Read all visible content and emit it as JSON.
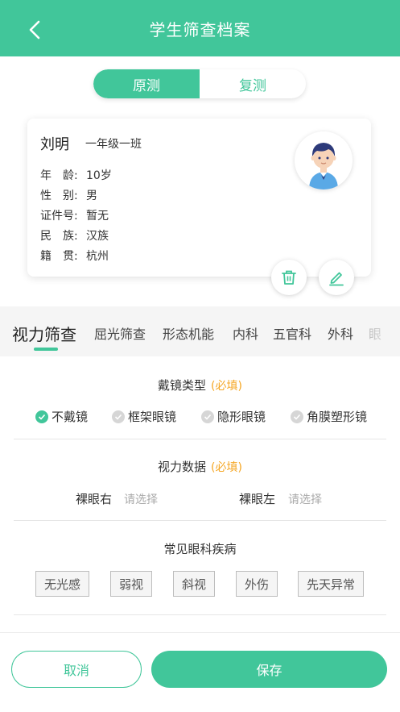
{
  "header": {
    "title": "学生筛查档案"
  },
  "segment": {
    "options": [
      "原测",
      "复测"
    ],
    "selected": "原测"
  },
  "student": {
    "name": "刘明",
    "class": "一年级一班",
    "fields": [
      {
        "label": "年　龄:",
        "value": "10岁"
      },
      {
        "label": "性　别:",
        "value": "男"
      },
      {
        "label": "证件号:",
        "value": "暂无"
      },
      {
        "label": "民　族:",
        "value": "汉族"
      },
      {
        "label": "籍　贯:",
        "value": "杭州"
      }
    ]
  },
  "tabs": [
    "视力筛查",
    "屈光筛查",
    "形态机能",
    "内科",
    "五官科",
    "外科",
    "眼"
  ],
  "active_tab": "视力筛查",
  "glasses": {
    "title": "戴镜类型",
    "required": "(必填)",
    "options": [
      "不戴镜",
      "框架眼镜",
      "隐形眼镜",
      "角膜塑形镜"
    ],
    "selected": "不戴镜"
  },
  "vision": {
    "title": "视力数据",
    "required": "(必填)",
    "right_label": "裸眼右",
    "right_placeholder": "请选择",
    "left_label": "裸眼左",
    "left_placeholder": "请选择"
  },
  "diseases": {
    "title": "常见眼科疾病",
    "options": [
      "无光感",
      "弱视",
      "斜视",
      "外伤",
      "先天异常"
    ]
  },
  "footer": {
    "cancel": "取消",
    "save": "保存"
  },
  "colors": {
    "accent": "#41c69a",
    "required": "#f5a623"
  }
}
